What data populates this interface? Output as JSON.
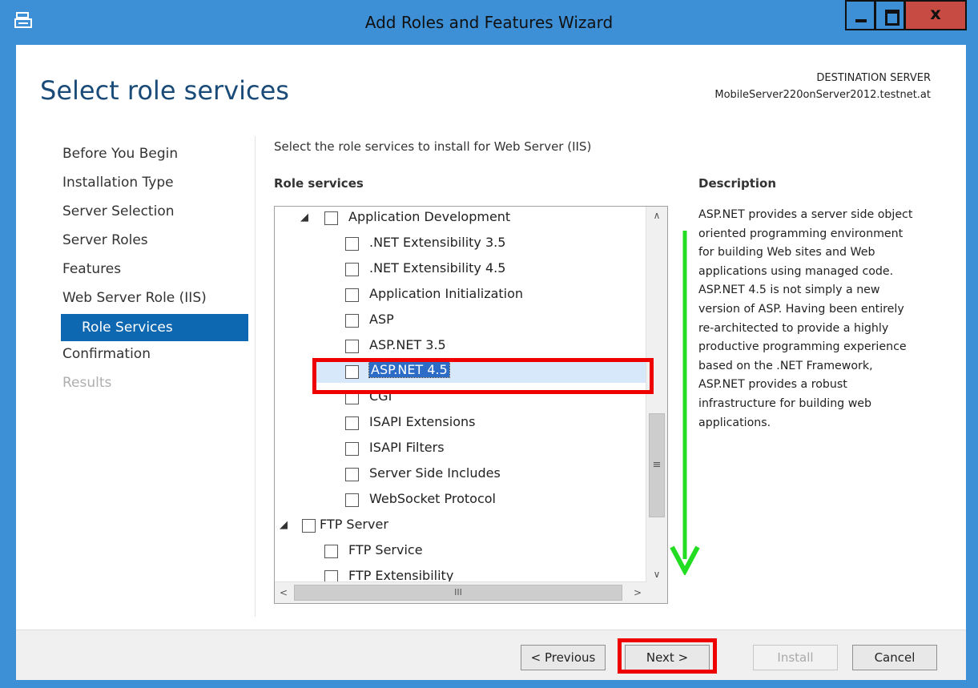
{
  "window": {
    "title": "Add Roles and Features Wizard",
    "minimize_glyph": "_",
    "close_glyph": "x"
  },
  "header": {
    "page_title": "Select role services",
    "destination_label": "DESTINATION SERVER",
    "destination_server": "MobileServer220onServer2012.testnet.at"
  },
  "nav": {
    "items": [
      {
        "label": "Before You Begin",
        "state": "normal"
      },
      {
        "label": "Installation Type",
        "state": "normal"
      },
      {
        "label": "Server Selection",
        "state": "normal"
      },
      {
        "label": "Server Roles",
        "state": "normal"
      },
      {
        "label": "Features",
        "state": "normal"
      },
      {
        "label": "Web Server Role (IIS)",
        "state": "normal"
      },
      {
        "label": "Role Services",
        "state": "active"
      },
      {
        "label": "Confirmation",
        "state": "normal"
      },
      {
        "label": "Results",
        "state": "disabled"
      }
    ]
  },
  "main": {
    "instruction": "Select the role services to install for Web Server (IIS)",
    "role_services_label": "Role services",
    "tree": [
      {
        "label": "Application Development",
        "level": 1,
        "expanded": true,
        "checked": false
      },
      {
        "label": ".NET Extensibility 3.5",
        "level": 2,
        "checked": false
      },
      {
        "label": ".NET Extensibility 4.5",
        "level": 2,
        "checked": false
      },
      {
        "label": "Application Initialization",
        "level": 2,
        "checked": false
      },
      {
        "label": "ASP",
        "level": 2,
        "checked": false
      },
      {
        "label": "ASP.NET 3.5",
        "level": 2,
        "checked": false
      },
      {
        "label": "ASP.NET 4.5",
        "level": 2,
        "checked": false,
        "selected": true
      },
      {
        "label": "CGI",
        "level": 2,
        "checked": false
      },
      {
        "label": "ISAPI Extensions",
        "level": 2,
        "checked": false
      },
      {
        "label": "ISAPI Filters",
        "level": 2,
        "checked": false
      },
      {
        "label": "Server Side Includes",
        "level": 2,
        "checked": false
      },
      {
        "label": "WebSocket Protocol",
        "level": 2,
        "checked": false
      },
      {
        "label": "FTP Server",
        "level": 0,
        "expanded": true,
        "checked": false
      },
      {
        "label": "FTP Service",
        "level": 1,
        "checked": false
      },
      {
        "label": "FTP Extensibility",
        "level": 1,
        "checked": false,
        "partially_visible": true
      }
    ],
    "description_label": "Description",
    "description_text": "ASP.NET provides a server side object oriented programming environment for building Web sites and Web applications using managed code. ASP.NET 4.5 is not simply a new version of ASP. Having been entirely re-architected to provide a highly productive programming experience based on the .NET Framework, ASP.NET provides a robust infrastructure for building web applications."
  },
  "buttons": {
    "previous": "< Previous",
    "next": "Next >",
    "install": "Install",
    "cancel": "Cancel"
  },
  "scrollbar": {
    "up": "∧",
    "down": "∨",
    "left": "<",
    "right": ">",
    "grip": "≡",
    "hgrip": "III"
  },
  "colors": {
    "window_frame": "#3d8fd6",
    "close_button": "#c74b43",
    "nav_active": "#0e67b1",
    "heading": "#1a4b78",
    "annotation_red": "#ee0000",
    "annotation_green": "#22dd22"
  }
}
